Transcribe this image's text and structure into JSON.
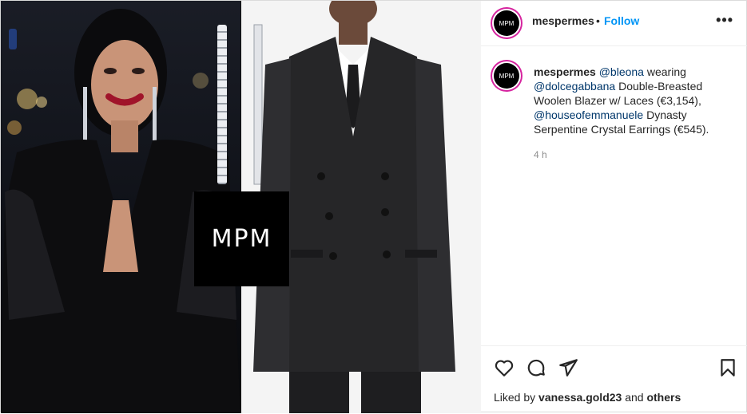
{
  "header": {
    "avatar_text": "MPM",
    "username": "mespermes",
    "separator": "•",
    "follow_label": "Follow",
    "more_icon": "more-horizontal-icon"
  },
  "caption": {
    "username": "mespermes",
    "mention_1": "@bleona",
    "text_1": " wearing ",
    "mention_2": "@dolcegabbana",
    "text_2": " Double-Breasted Woolen Blazer w/ Laces (€3,154), ",
    "mention_3": "@houseofemmanuele",
    "text_3": " Dynasty Serpentine Crystal Earrings (€545).",
    "time": "4 h"
  },
  "media": {
    "logo_text": "MPM"
  },
  "actions": {
    "like_icon": "heart-icon",
    "comment_icon": "comment-icon",
    "share_icon": "send-icon",
    "save_icon": "bookmark-icon",
    "liked_prefix": "Liked by ",
    "liked_user": "vanessa.gold23",
    "liked_middle": " and ",
    "liked_others": "others"
  }
}
